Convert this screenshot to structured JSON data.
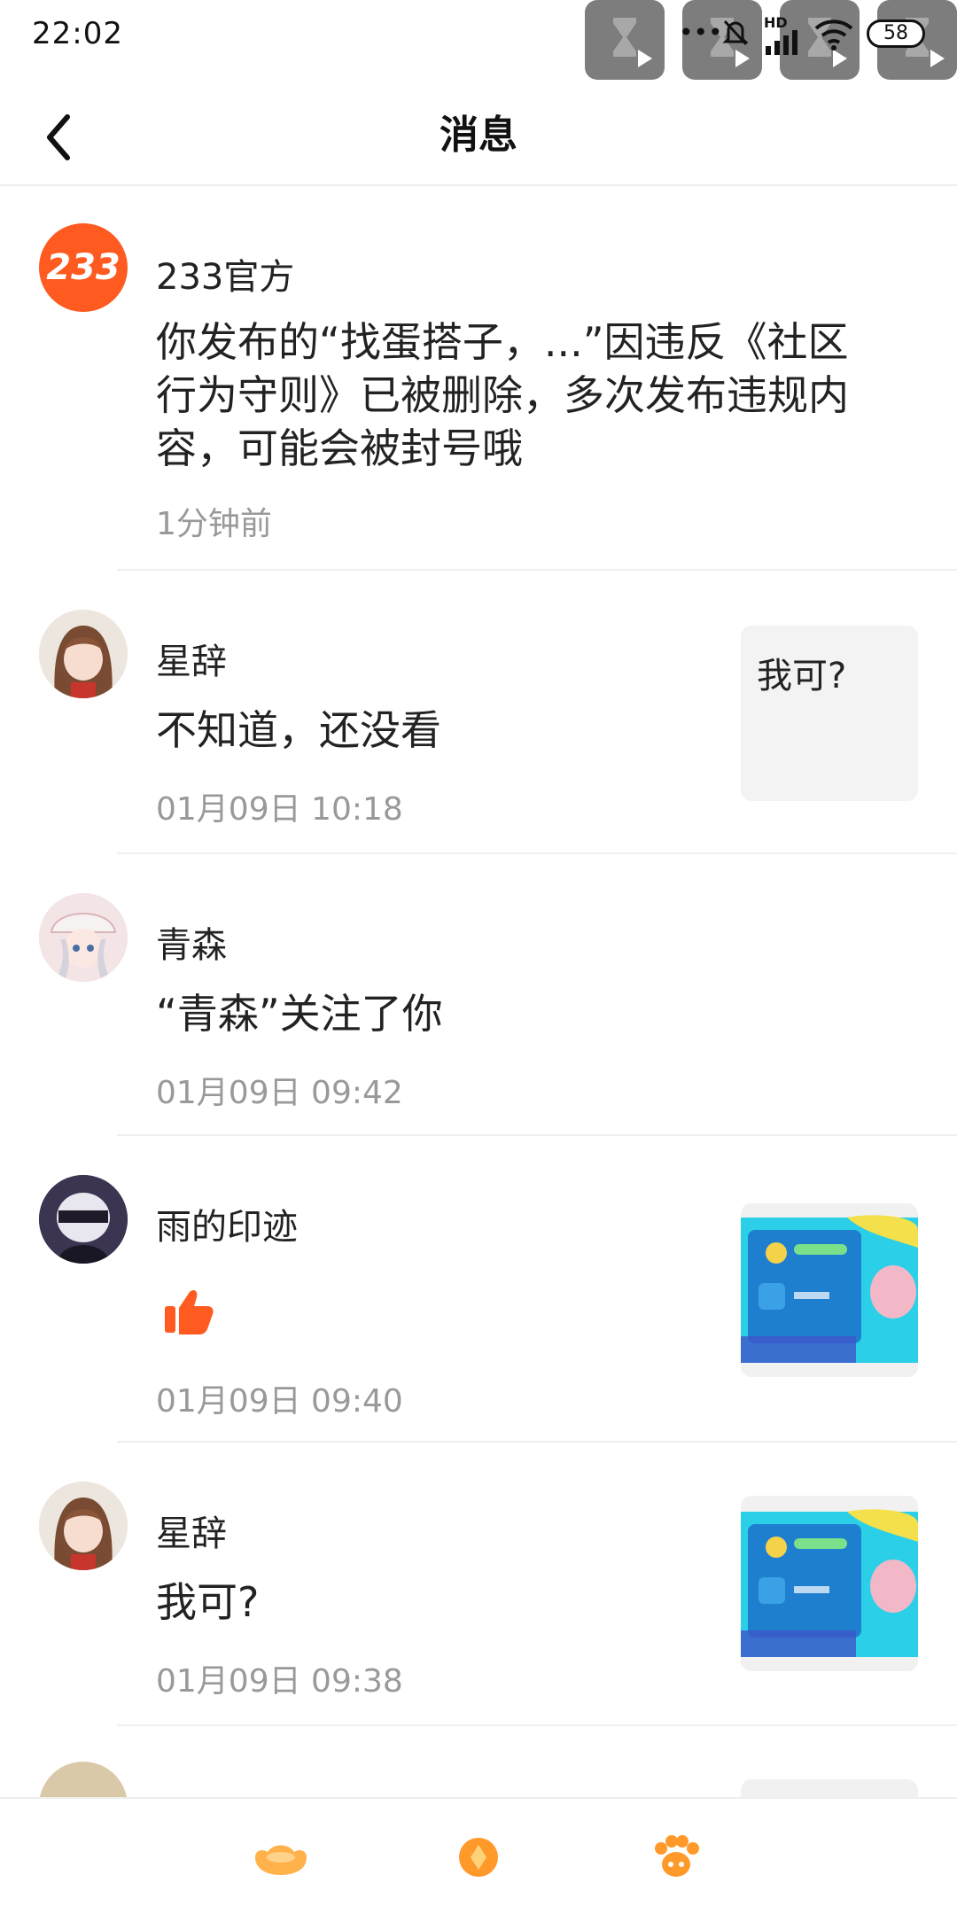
{
  "status": {
    "time": "22:02",
    "battery": "58",
    "hd_label": "HD"
  },
  "header": {
    "title": "消息",
    "back_icon": "chevron-left-icon"
  },
  "messages": [
    {
      "name": "233官方",
      "avatar_text": "233",
      "content": "你发布的“找蛋搭子，...”因违反《社区行为守则》已被删除，多次发布违规内容，可能会被封号哦",
      "time": "1分钟前"
    },
    {
      "name": "星辞",
      "content": "不知道，还没看",
      "time": "01月09日 10:18",
      "thumb_text": "我可?"
    },
    {
      "name": "青森",
      "content": "“青森”关注了你",
      "time": "01月09日 09:42"
    },
    {
      "name": "雨的印迹",
      "content_icon": "thumbs-up-icon",
      "time": "01月09日 09:40",
      "thumb_image": "game-screenshot"
    },
    {
      "name": "星辞",
      "content": "我可?",
      "time": "01月09日 09:38",
      "thumb_image": "game-screenshot"
    }
  ],
  "bottom_nav": [
    "gold-ingot-icon",
    "coin-icon",
    "paw-icon"
  ],
  "colors": {
    "accent_orange": "#ff5a1f",
    "text_main": "#222222",
    "text_sub": "#999999"
  }
}
